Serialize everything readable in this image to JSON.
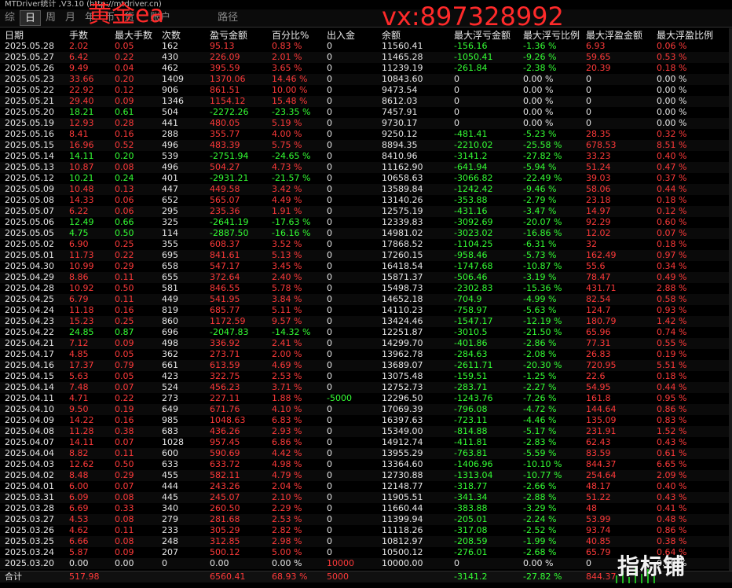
{
  "window_title": "MTDriver统计 ,V3.10 (http://mtdriver.cn)",
  "tabs": [
    "综",
    "日",
    "周",
    "月",
    "年",
    "币",
    "货",
    "账户",
    "路径"
  ],
  "active_tab": 1,
  "watermarks": {
    "left": "黄金ea",
    "right": "vx:897328992"
  },
  "logo_text": "指标铺",
  "colors": {
    "positive": "#ff3a3a",
    "negative": "#34ff34",
    "background": "#000000"
  },
  "columns": [
    "日期",
    "手数",
    "最大手数",
    "次数",
    "盈亏金额",
    "百分比%",
    "出入金",
    "余额",
    "最大浮亏金额",
    "最大浮亏比例",
    "最大浮盈金额",
    "最大浮盈比例"
  ],
  "rows": [
    [
      "2025.05.28",
      "2.02",
      "0.05",
      "162",
      "95.13",
      "0.83 %",
      "0",
      "11560.41",
      "-156.16",
      "-1.36 %",
      "6.93",
      "0.06 %"
    ],
    [
      "2025.05.27",
      "6.42",
      "0.22",
      "430",
      "226.09",
      "2.01 %",
      "0",
      "11465.28",
      "-1050.41",
      "-9.26 %",
      "59.65",
      "0.53 %"
    ],
    [
      "2025.05.26",
      "9.49",
      "0.04",
      "462",
      "395.59",
      "3.65 %",
      "0",
      "11239.19",
      "-261.84",
      "-2.38 %",
      "20.39",
      "0.18 %"
    ],
    [
      "2025.05.23",
      "33.66",
      "0.20",
      "1409",
      "1370.06",
      "14.46 %",
      "0",
      "10843.60",
      "0",
      "0.00 %",
      "0",
      "0.00 %"
    ],
    [
      "2025.05.22",
      "22.92",
      "0.12",
      "906",
      "861.51",
      "10.00 %",
      "0",
      "9473.54",
      "0",
      "0.00 %",
      "0",
      "0.00 %"
    ],
    [
      "2025.05.21",
      "29.40",
      "0.09",
      "1346",
      "1154.12",
      "15.48 %",
      "0",
      "8612.03",
      "0",
      "0.00 %",
      "0",
      "0.00 %"
    ],
    [
      "2025.05.20",
      "18.21",
      "0.61",
      "504",
      "-2272.26",
      "-23.35 %",
      "0",
      "7457.91",
      "0",
      "0.00 %",
      "0",
      "0.00 %"
    ],
    [
      "2025.05.19",
      "12.93",
      "0.28",
      "441",
      "480.05",
      "5.19 %",
      "0",
      "9730.17",
      "0",
      "0.00 %",
      "0",
      "0.00 %"
    ],
    [
      "2025.05.16",
      "8.41",
      "0.16",
      "288",
      "355.77",
      "4.00 %",
      "0",
      "9250.12",
      "-481.41",
      "-5.23 %",
      "28.35",
      "0.32 %"
    ],
    [
      "2025.05.15",
      "16.96",
      "0.52",
      "496",
      "483.39",
      "5.75 %",
      "0",
      "8894.35",
      "-2210.02",
      "-25.58 %",
      "678.53",
      "8.51 %"
    ],
    [
      "2025.05.14",
      "14.11",
      "0.20",
      "539",
      "-2751.94",
      "-24.65 %",
      "0",
      "8410.96",
      "-3141.2",
      "-27.82 %",
      "33.23",
      "0.40 %"
    ],
    [
      "2025.05.13",
      "10.87",
      "0.08",
      "496",
      "504.27",
      "4.73 %",
      "0",
      "11162.90",
      "-641.94",
      "-5.94 %",
      "51.24",
      "0.47 %"
    ],
    [
      "2025.05.12",
      "10.21",
      "0.24",
      "401",
      "-2931.21",
      "-21.57 %",
      "0",
      "10658.63",
      "-3066.82",
      "-22.49 %",
      "39.03",
      "0.37 %"
    ],
    [
      "2025.05.09",
      "10.48",
      "0.13",
      "447",
      "449.58",
      "3.42 %",
      "0",
      "13589.84",
      "-1242.42",
      "-9.46 %",
      "58.06",
      "0.44 %"
    ],
    [
      "2025.05.08",
      "14.33",
      "0.06",
      "652",
      "565.07",
      "4.49 %",
      "0",
      "13140.26",
      "-353.88",
      "-2.79 %",
      "23.18",
      "0.18 %"
    ],
    [
      "2025.05.07",
      "6.22",
      "0.06",
      "295",
      "235.36",
      "1.91 %",
      "0",
      "12575.19",
      "-431.16",
      "-3.47 %",
      "14.97",
      "0.12 %"
    ],
    [
      "2025.05.06",
      "12.49",
      "0.66",
      "325",
      "-2641.19",
      "-17.63 %",
      "0",
      "12339.83",
      "-3092.69",
      "-20.07 %",
      "92.29",
      "0.60 %"
    ],
    [
      "2025.05.05",
      "4.75",
      "0.50",
      "114",
      "-2887.50",
      "-16.16 %",
      "0",
      "14981.02",
      "-3023.02",
      "-16.86 %",
      "12.02",
      "0.07 %"
    ],
    [
      "2025.05.02",
      "6.90",
      "0.25",
      "355",
      "608.37",
      "3.52 %",
      "0",
      "17868.52",
      "-1104.25",
      "-6.31 %",
      "32",
      "0.18 %"
    ],
    [
      "2025.05.01",
      "11.73",
      "0.22",
      "695",
      "841.61",
      "5.13 %",
      "0",
      "17260.15",
      "-958.46",
      "-5.73 %",
      "162.49",
      "0.97 %"
    ],
    [
      "2025.04.30",
      "10.99",
      "0.29",
      "658",
      "547.17",
      "3.45 %",
      "0",
      "16418.54",
      "-1747.68",
      "-10.87 %",
      "55.6",
      "0.34 %"
    ],
    [
      "2025.04.29",
      "8.86",
      "0.11",
      "655",
      "372.64",
      "2.40 %",
      "0",
      "15871.37",
      "-506.46",
      "-3.19 %",
      "78.47",
      "0.49 %"
    ],
    [
      "2025.04.28",
      "10.92",
      "0.50",
      "581",
      "846.55",
      "5.78 %",
      "0",
      "15498.73",
      "-2302.83",
      "-15.36 %",
      "431.71",
      "2.88 %"
    ],
    [
      "2025.04.25",
      "6.79",
      "0.11",
      "449",
      "541.95",
      "3.84 %",
      "0",
      "14652.18",
      "-704.9",
      "-4.99 %",
      "82.54",
      "0.58 %"
    ],
    [
      "2025.04.24",
      "11.18",
      "0.16",
      "819",
      "685.77",
      "5.11 %",
      "0",
      "14110.23",
      "-758.97",
      "-5.63 %",
      "124.7",
      "0.93 %"
    ],
    [
      "2025.04.23",
      "15.23",
      "0.25",
      "860",
      "1172.59",
      "9.57 %",
      "0",
      "13424.46",
      "-1547.17",
      "-12.19 %",
      "180.79",
      "1.42 %"
    ],
    [
      "2025.04.22",
      "24.85",
      "0.87",
      "696",
      "-2047.83",
      "-14.32 %",
      "0",
      "12251.87",
      "-3010.5",
      "-21.50 %",
      "65.96",
      "0.74 %"
    ],
    [
      "2025.04.21",
      "7.12",
      "0.09",
      "498",
      "336.92",
      "2.41 %",
      "0",
      "14299.70",
      "-401.86",
      "-2.86 %",
      "77.31",
      "0.55 %"
    ],
    [
      "2025.04.17",
      "4.85",
      "0.05",
      "362",
      "273.71",
      "2.00 %",
      "0",
      "13962.78",
      "-284.63",
      "-2.08 %",
      "26.83",
      "0.19 %"
    ],
    [
      "2025.04.16",
      "17.37",
      "0.79",
      "661",
      "613.59",
      "4.69 %",
      "0",
      "13689.07",
      "-2611.71",
      "-20.30 %",
      "720.95",
      "5.51 %"
    ],
    [
      "2025.04.15",
      "5.63",
      "0.05",
      "423",
      "322.75",
      "2.53 %",
      "0",
      "13075.48",
      "-159.51",
      "-1.25 %",
      "22.6",
      "0.18 %"
    ],
    [
      "2025.04.14",
      "7.48",
      "0.07",
      "524",
      "456.23",
      "3.71 %",
      "0",
      "12752.73",
      "-283.71",
      "-2.27 %",
      "54.95",
      "0.44 %"
    ],
    [
      "2025.04.11",
      "4.71",
      "0.22",
      "273",
      "227.11",
      "1.88 %",
      "-5000",
      "12296.50",
      "-1243.76",
      "-7.26 %",
      "161.8",
      "0.95 %"
    ],
    [
      "2025.04.10",
      "9.50",
      "0.19",
      "649",
      "671.76",
      "4.10 %",
      "0",
      "17069.39",
      "-796.08",
      "-4.72 %",
      "144.64",
      "0.86 %"
    ],
    [
      "2025.04.09",
      "14.22",
      "0.16",
      "985",
      "1048.63",
      "6.83 %",
      "0",
      "16397.63",
      "-723.11",
      "-4.46 %",
      "135.09",
      "0.83 %"
    ],
    [
      "2025.04.08",
      "11.28",
      "0.38",
      "683",
      "436.26",
      "2.93 %",
      "0",
      "15349.00",
      "-814.88",
      "-5.17 %",
      "231.91",
      "1.52 %"
    ],
    [
      "2025.04.07",
      "14.11",
      "0.07",
      "1028",
      "957.45",
      "6.86 %",
      "0",
      "14912.74",
      "-411.81",
      "-2.83 %",
      "62.43",
      "0.43 %"
    ],
    [
      "2025.04.04",
      "8.82",
      "0.11",
      "600",
      "590.69",
      "4.42 %",
      "0",
      "13955.29",
      "-763.81",
      "-5.59 %",
      "83.59",
      "0.61 %"
    ],
    [
      "2025.04.03",
      "12.62",
      "0.50",
      "633",
      "633.72",
      "4.98 %",
      "0",
      "13364.60",
      "-1406.96",
      "-10.10 %",
      "844.37",
      "6.65 %"
    ],
    [
      "2025.04.02",
      "8.48",
      "0.29",
      "455",
      "582.11",
      "4.79 %",
      "0",
      "12730.88",
      "-1313.04",
      "-10.77 %",
      "254.64",
      "2.09 %"
    ],
    [
      "2025.04.01",
      "6.00",
      "0.07",
      "444",
      "243.26",
      "2.04 %",
      "0",
      "12148.77",
      "-318.77",
      "-2.66 %",
      "48.17",
      "0.40 %"
    ],
    [
      "2025.03.31",
      "6.09",
      "0.08",
      "445",
      "245.07",
      "2.10 %",
      "0",
      "11905.51",
      "-341.34",
      "-2.88 %",
      "51.22",
      "0.43 %"
    ],
    [
      "2025.03.28",
      "6.69",
      "0.33",
      "340",
      "260.50",
      "2.29 %",
      "0",
      "11660.44",
      "-383.88",
      "-3.29 %",
      "48",
      "0.41 %"
    ],
    [
      "2025.03.27",
      "4.53",
      "0.08",
      "279",
      "281.68",
      "2.53 %",
      "0",
      "11399.94",
      "-205.01",
      "-2.24 %",
      "53.99",
      "0.48 %"
    ],
    [
      "2025.03.26",
      "4.62",
      "0.11",
      "233",
      "305.29",
      "2.82 %",
      "0",
      "11118.26",
      "-317.08",
      "-2.52 %",
      "93.74",
      "0.86 %"
    ],
    [
      "2025.03.25",
      "6.66",
      "0.08",
      "248",
      "312.85",
      "2.98 %",
      "0",
      "10812.97",
      "-208.59",
      "-1.99 %",
      "40.85",
      "0.38 %"
    ],
    [
      "2025.03.24",
      "5.87",
      "0.09",
      "207",
      "500.12",
      "5.00 %",
      "0",
      "10500.12",
      "-276.01",
      "-2.68 %",
      "65.79",
      "0.64 %"
    ],
    [
      "2025.03.20",
      "0.00",
      "0.00",
      "0",
      "0.00",
      "0.00 %",
      "10000",
      "10000.00",
      "0",
      "0.00 %",
      "0",
      "0.00 %"
    ]
  ],
  "footer": {
    "label": "合计",
    "lots": "517.98",
    "pnl": "6560.41",
    "pct": "68.93 %",
    "deposit": "5000",
    "max_loss": "-3141.2",
    "max_loss_pct": "-27.82 %",
    "max_profit": "844.37"
  }
}
